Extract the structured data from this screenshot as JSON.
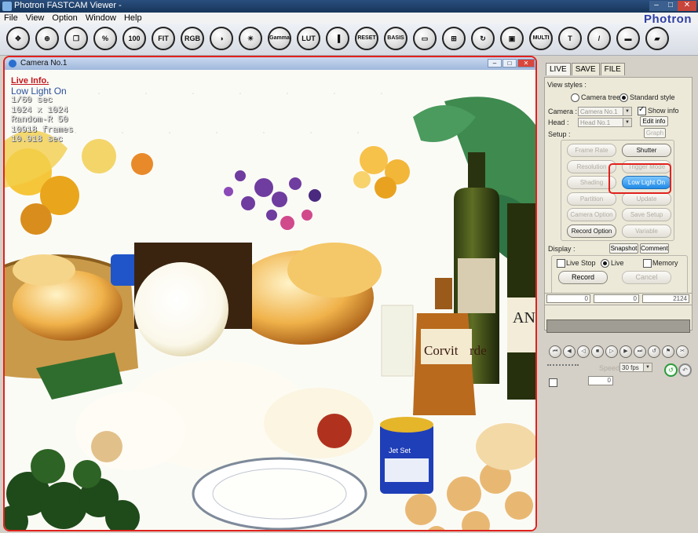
{
  "window": {
    "title": "Photron FASTCAM Viewer -",
    "brand": "Photron"
  },
  "menu": [
    "File",
    "View",
    "Option",
    "Window",
    "Help"
  ],
  "toolbar": [
    {
      "name": "move-icon",
      "label": "✥"
    },
    {
      "name": "zoom-in-icon",
      "label": "⊕"
    },
    {
      "name": "copy-icon",
      "label": "❐"
    },
    {
      "name": "percent-icon",
      "label": "%"
    },
    {
      "name": "zoom-100-icon",
      "label": "100"
    },
    {
      "name": "fit-icon",
      "label": "FIT"
    },
    {
      "name": "rgb-icon",
      "label": "RGB"
    },
    {
      "name": "contrast-icon",
      "label": "◑"
    },
    {
      "name": "brightness-icon",
      "label": "☀"
    },
    {
      "name": "gamma-icon",
      "label": "Gamma"
    },
    {
      "name": "lut-reset-icon",
      "label": "LUT"
    },
    {
      "name": "color-bars-icon",
      "label": "▐"
    },
    {
      "name": "reset-icon",
      "label": "RESET"
    },
    {
      "name": "basis-icon",
      "label": "BASIS"
    },
    {
      "name": "rectangle-icon",
      "label": "▭"
    },
    {
      "name": "split-icon",
      "label": "⊞"
    },
    {
      "name": "refresh-icon",
      "label": "↻"
    },
    {
      "name": "multi-window-icon",
      "label": "▣"
    },
    {
      "name": "multi-lock-icon",
      "label": "MULTI"
    },
    {
      "name": "trigger-icon",
      "label": "T"
    },
    {
      "name": "pen-icon",
      "label": "/"
    },
    {
      "name": "display-icon",
      "label": "▬"
    },
    {
      "name": "eraser-icon",
      "label": "▰"
    }
  ],
  "camera_window": {
    "title": "Camera No.1",
    "info": {
      "header": "Live Info.",
      "mode": "Low Light On",
      "shutter": "1/60 sec",
      "resolution": "1024 x 1024",
      "random": "Random-R 50",
      "frames": "10918 frames",
      "duration": "10.918 sec"
    },
    "scene_text": {
      "label1": "Corvit",
      "label2": "rde",
      "label3": "AN",
      "tin": "Jet Set"
    }
  },
  "panel": {
    "tabs": [
      "LIVE",
      "SAVE",
      "FILE"
    ],
    "view_styles_label": "View styles :",
    "camera_tree": "Camera tree",
    "standard_style": "Standard style",
    "camera_label": "Camera :",
    "camera_value": "Camera No.1",
    "head_label": "Head :",
    "head_value": "Head No.1",
    "show_info": "Show info",
    "edit_info": "Edit info",
    "graph": "Graph",
    "setup_label": "Setup :",
    "setup_buttons": [
      {
        "label": "Frame Rate",
        "state": "disabled"
      },
      {
        "label": "Shutter",
        "state": "enabled"
      },
      {
        "label": "Resolution",
        "state": "disabled"
      },
      {
        "label": "Trigger Mode",
        "state": "disabled"
      },
      {
        "label": "Shading",
        "state": "disabled"
      },
      {
        "label": "Low Light On",
        "state": "active"
      },
      {
        "label": "Partition",
        "state": "disabled"
      },
      {
        "label": "Update",
        "state": "disabled"
      },
      {
        "label": "Camera Option",
        "state": "disabled"
      },
      {
        "label": "Save Setup",
        "state": "disabled"
      },
      {
        "label": "Record Option",
        "state": "enabled"
      },
      {
        "label": "Variable",
        "state": "disabled"
      }
    ],
    "display_label": "Display :",
    "snapshot": "Snapshot",
    "comment": "Comment",
    "live_stop": "Live Stop",
    "live": "Live",
    "memory": "Memory",
    "record": "Record",
    "cancel": "Cancel",
    "slider": {
      "start": "0",
      "mid": "0",
      "end": "2124"
    },
    "fps": "30 fps",
    "frame_step": "0",
    "playback_label": "Speed"
  }
}
